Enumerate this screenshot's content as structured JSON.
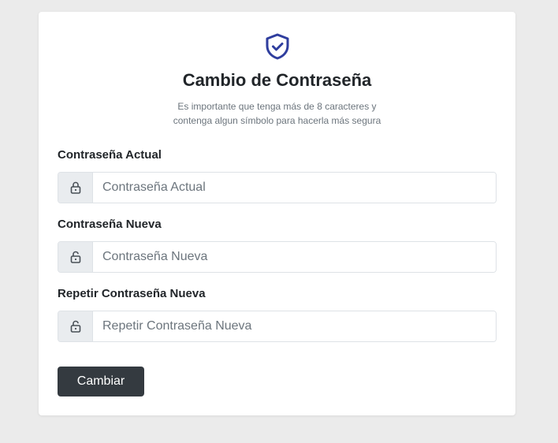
{
  "header": {
    "icon": "shield-check-icon",
    "accent_color": "#2f3e9e",
    "title": "Cambio de Contraseña",
    "subtitle": "Es importante que tenga más de 8 caracteres y contenga algun símbolo para hacerla más segura"
  },
  "form": {
    "fields": [
      {
        "label": "Contraseña Actual",
        "placeholder": "Contraseña Actual",
        "value": "",
        "icon": "lock-icon"
      },
      {
        "label": "Contraseña Nueva",
        "placeholder": "Contraseña Nueva",
        "value": "",
        "icon": "lock-open-icon"
      },
      {
        "label": "Repetir Contraseña Nueva",
        "placeholder": "Repetir Contraseña Nueva",
        "value": "",
        "icon": "lock-open-icon"
      }
    ],
    "submit_label": "Cambiar",
    "submit_color": "#343a40"
  }
}
